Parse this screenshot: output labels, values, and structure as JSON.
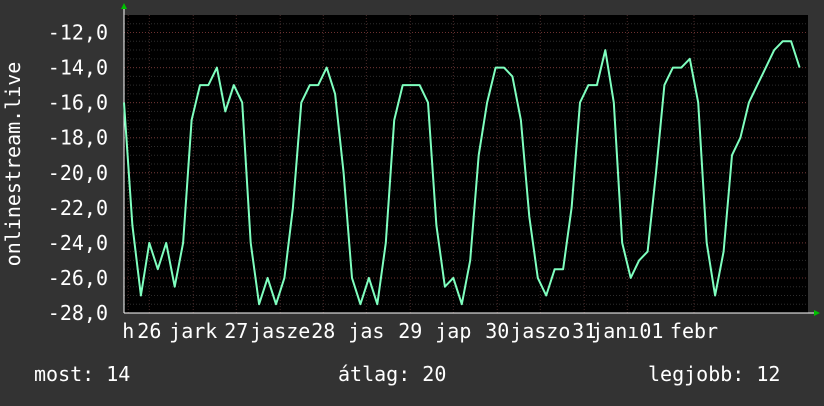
{
  "chart_data": {
    "type": "line",
    "ylabel": "onlinestream.live",
    "ylim": [
      -28,
      -11
    ],
    "yticks": [
      -12,
      -14,
      -16,
      -18,
      -20,
      -22,
      -24,
      -26,
      -28
    ],
    "ytick_labels": [
      "-12,0",
      "-14,0",
      "-16,0",
      "-18,0",
      "-20,0",
      "-22,0",
      "-24,0",
      "-26,0",
      "-28,0"
    ],
    "xlim": [
      0,
      8.1
    ],
    "xticks": [
      {
        "x": 0.05,
        "label": "h"
      },
      {
        "x": 0.3,
        "label": "26"
      },
      {
        "x": 0.82,
        "label": "jark"
      },
      {
        "x": 1.33,
        "label": "27"
      },
      {
        "x": 1.85,
        "label": "jasze"
      },
      {
        "x": 2.36,
        "label": "28"
      },
      {
        "x": 2.87,
        "label": "jas"
      },
      {
        "x": 3.39,
        "label": "29"
      },
      {
        "x": 3.9,
        "label": "jap"
      },
      {
        "x": 4.42,
        "label": "30"
      },
      {
        "x": 4.93,
        "label": "jaszo"
      },
      {
        "x": 5.45,
        "label": "31"
      },
      {
        "x": 5.96,
        "label": "janı01"
      },
      {
        "x": 6.75,
        "label": "febr"
      }
    ],
    "grid": true,
    "background": "#000000",
    "line_color": "#7fffbf",
    "series": [
      {
        "x": [
          0,
          0.1,
          0.2,
          0.3,
          0.4,
          0.5,
          0.6,
          0.7,
          0.8,
          0.9,
          1.0,
          1.1,
          1.2,
          1.3,
          1.4,
          1.5,
          1.6,
          1.7,
          1.8,
          1.9,
          2.0,
          2.1,
          2.2,
          2.3,
          2.4,
          2.5,
          2.6,
          2.7,
          2.8,
          2.9,
          3.0,
          3.1,
          3.2,
          3.3,
          3.4,
          3.5,
          3.6,
          3.7,
          3.8,
          3.9,
          4.0,
          4.1,
          4.2,
          4.3,
          4.4,
          4.5,
          4.6,
          4.7,
          4.8,
          4.9,
          5.0,
          5.1,
          5.2,
          5.3,
          5.4,
          5.5,
          5.6,
          5.7,
          5.8,
          5.9,
          6.0,
          6.1,
          6.2,
          6.3,
          6.4,
          6.5,
          6.6,
          6.7,
          6.8,
          6.9,
          7.0,
          7.1,
          7.2,
          7.3,
          7.4,
          7.5,
          7.6,
          7.7,
          7.8,
          7.9,
          8.0
        ],
        "values": [
          -16,
          -23,
          -27,
          -24,
          -25.5,
          -24,
          -26.5,
          -24,
          -17,
          -15,
          -15,
          -14,
          -16.5,
          -15,
          -16,
          -24,
          -27.5,
          -26,
          -27.5,
          -26,
          -22,
          -16,
          -15,
          -15,
          -14,
          -15.5,
          -20,
          -26,
          -27.5,
          -26,
          -27.5,
          -24,
          -17,
          -15,
          -15,
          -15,
          -16,
          -23,
          -26.5,
          -26,
          -27.5,
          -25,
          -19,
          -16,
          -14,
          -14,
          -14.5,
          -17,
          -22.5,
          -26,
          -27,
          -25.5,
          -25.5,
          -22,
          -16,
          -15,
          -15,
          -13,
          -16,
          -24,
          -26,
          -25,
          -24.5,
          -20,
          -15,
          -14,
          -14,
          -13.5,
          -16,
          -24,
          -27,
          -24.5,
          -19,
          -18,
          -16,
          -15,
          -14,
          -13,
          -12.5,
          -12.5,
          -14
        ]
      }
    ]
  },
  "stats": {
    "current": "most: 14",
    "average": "átlag: 20",
    "best": "legjobb: 12"
  }
}
